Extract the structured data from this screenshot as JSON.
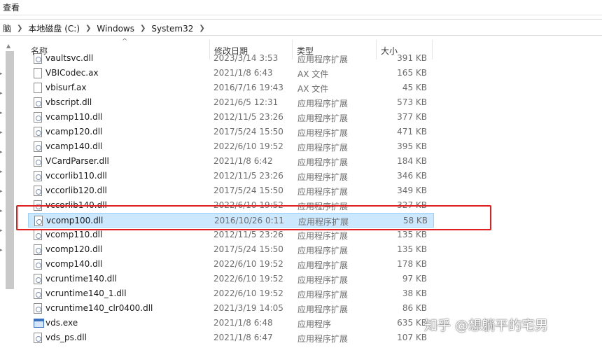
{
  "ribbon": {
    "view_tab": "查看"
  },
  "address": {
    "crumbs": [
      "脑",
      "本地磁盘 (C:)",
      "Windows",
      "System32"
    ]
  },
  "columns": {
    "name": "名称",
    "date": "修改日期",
    "type": "类型",
    "size": "大小"
  },
  "sort_indicator": "^",
  "files": [
    {
      "name": "vaultsvc.dll",
      "date": "2023/3/14 3:53",
      "type": "应用程序扩展",
      "size": "391 KB",
      "icon": "dll-icon",
      "selected": false
    },
    {
      "name": "VBICodec.ax",
      "date": "2021/1/8 6:43",
      "type": "AX 文件",
      "size": "165 KB",
      "icon": "file-icon",
      "selected": false
    },
    {
      "name": "vbisurf.ax",
      "date": "2016/7/16 19:43",
      "type": "AX 文件",
      "size": "45 KB",
      "icon": "file-icon",
      "selected": false
    },
    {
      "name": "vbscript.dll",
      "date": "2021/6/5 12:31",
      "type": "应用程序扩展",
      "size": "573 KB",
      "icon": "dll-icon",
      "selected": false
    },
    {
      "name": "vcamp110.dll",
      "date": "2012/11/5 23:26",
      "type": "应用程序扩展",
      "size": "377 KB",
      "icon": "dll-icon",
      "selected": false
    },
    {
      "name": "vcamp120.dll",
      "date": "2017/5/24 15:50",
      "type": "应用程序扩展",
      "size": "471 KB",
      "icon": "dll-icon",
      "selected": false
    },
    {
      "name": "vcamp140.dll",
      "date": "2022/6/10 19:52",
      "type": "应用程序扩展",
      "size": "395 KB",
      "icon": "dll-icon",
      "selected": false
    },
    {
      "name": "VCardParser.dll",
      "date": "2021/1/8 6:42",
      "type": "应用程序扩展",
      "size": "184 KB",
      "icon": "dll-icon",
      "selected": false
    },
    {
      "name": "vccorlib110.dll",
      "date": "2012/11/5 23:26",
      "type": "应用程序扩展",
      "size": "346 KB",
      "icon": "dll-icon",
      "selected": false
    },
    {
      "name": "vccorlib120.dll",
      "date": "2017/5/24 15:50",
      "type": "应用程序扩展",
      "size": "349 KB",
      "icon": "dll-icon",
      "selected": false
    },
    {
      "name": "vccorlib140.dll",
      "date": "2022/6/10 19:52",
      "type": "应用程序扩展",
      "size": "327 KB",
      "icon": "dll-icon",
      "selected": false
    },
    {
      "name": "vcomp100.dll",
      "date": "2016/10/26 0:11",
      "type": "应用程序扩展",
      "size": "58 KB",
      "icon": "dll-icon",
      "selected": true
    },
    {
      "name": "vcomp110.dll",
      "date": "2012/11/5 23:26",
      "type": "应用程序扩展",
      "size": "135 KB",
      "icon": "dll-icon",
      "selected": false
    },
    {
      "name": "vcomp120.dll",
      "date": "2017/5/24 15:50",
      "type": "应用程序扩展",
      "size": "135 KB",
      "icon": "dll-icon",
      "selected": false
    },
    {
      "name": "vcomp140.dll",
      "date": "2022/6/10 19:52",
      "type": "应用程序扩展",
      "size": "178 KB",
      "icon": "dll-icon",
      "selected": false
    },
    {
      "name": "vcruntime140.dll",
      "date": "2022/6/10 19:52",
      "type": "应用程序扩展",
      "size": "97 KB",
      "icon": "dll-icon",
      "selected": false
    },
    {
      "name": "vcruntime140_1.dll",
      "date": "2022/6/10 19:52",
      "type": "应用程序扩展",
      "size": "38 KB",
      "icon": "dll-icon",
      "selected": false
    },
    {
      "name": "vcruntime140_clr0400.dll",
      "date": "2021/3/19 14:05",
      "type": "应用程序扩展",
      "size": "86 KB",
      "icon": "dll-icon",
      "selected": false
    },
    {
      "name": "vds.exe",
      "date": "2021/1/8 6:48",
      "type": "应用程序",
      "size": "635 KB",
      "icon": "exe-icon",
      "selected": false
    },
    {
      "name": "vds_ps.dll",
      "date": "2021/1/8 6:47",
      "type": "应用程序扩展",
      "size": "107 KB",
      "icon": "dll-icon",
      "selected": false
    }
  ],
  "watermark": "知乎 @想躺平的宅男",
  "colors": {
    "selection": "#cce8ff",
    "selection_border": "#99d1ff",
    "highlight_box": "#e02020"
  }
}
